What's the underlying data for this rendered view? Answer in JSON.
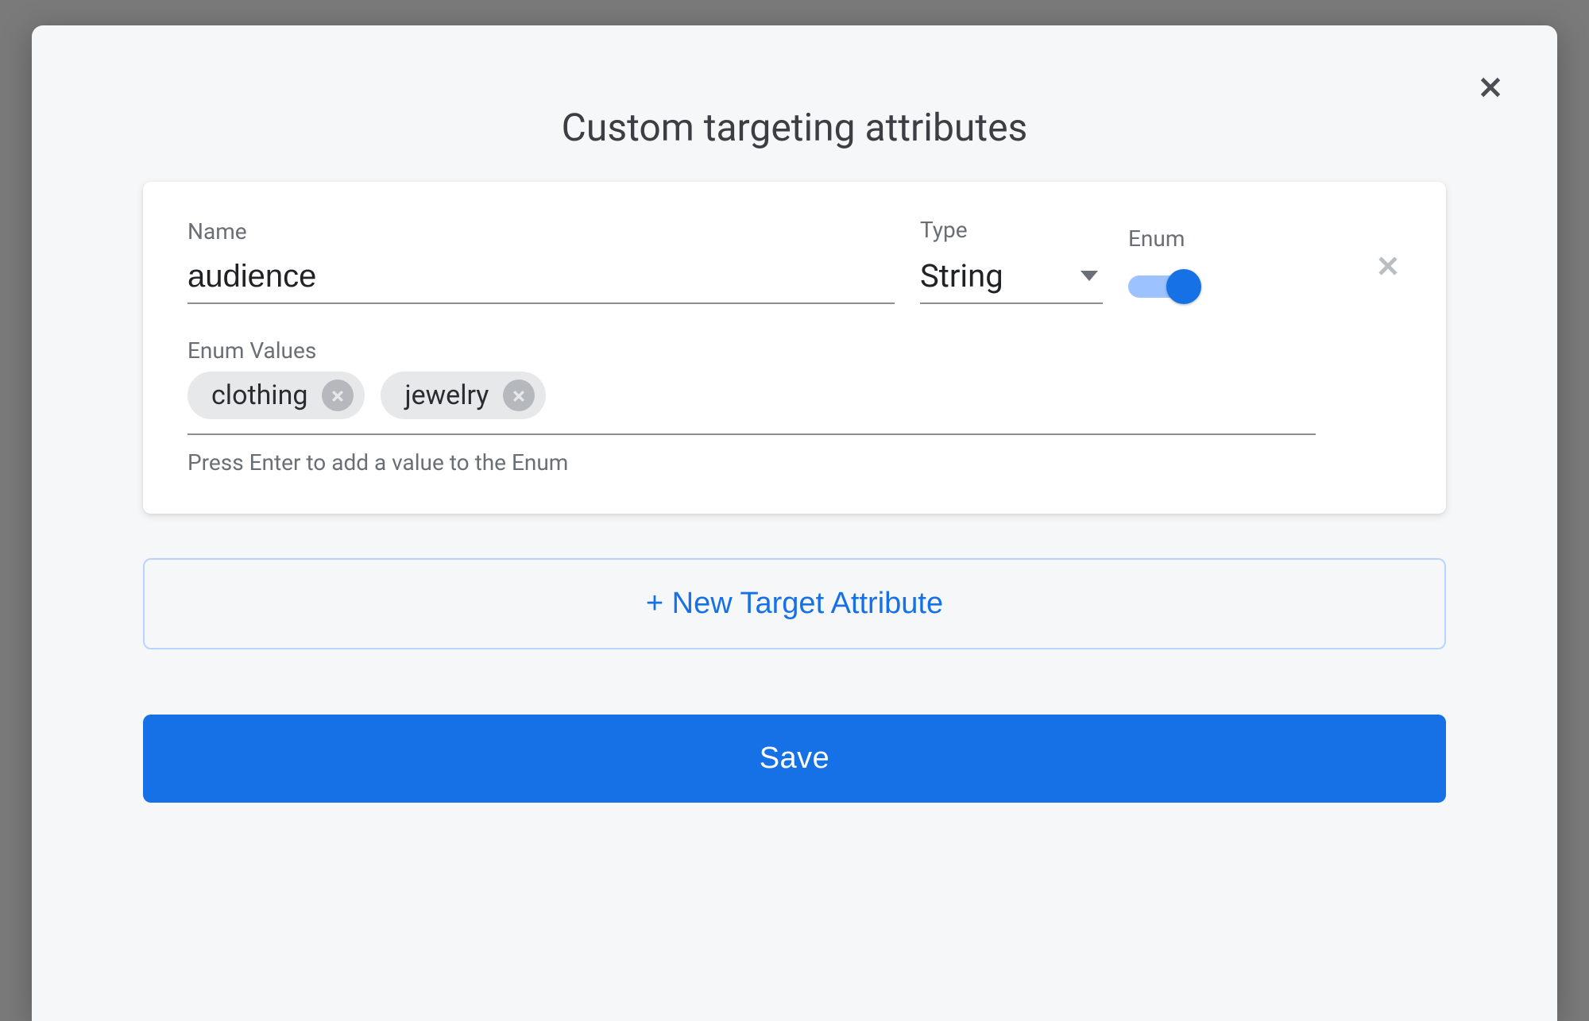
{
  "modal": {
    "title": "Custom targeting attributes",
    "close_icon": "close-icon"
  },
  "attribute": {
    "name_label": "Name",
    "name_value": "audience",
    "type_label": "Type",
    "type_value": "String",
    "enum_label": "Enum",
    "enum_on": true,
    "enum_values_label": "Enum Values",
    "enum_values": [
      "clothing",
      "jewelry"
    ],
    "enum_hint": "Press Enter to add a value to the Enum"
  },
  "buttons": {
    "new_target_attribute": "+ New Target Attribute",
    "save": "Save"
  },
  "colors": {
    "accent": "#1771e6",
    "toggle_track": "#9cc2ff",
    "chip_bg": "#e7e8ea",
    "chip_x_bg": "#b5b9bd",
    "text_muted": "#6a6f75"
  }
}
